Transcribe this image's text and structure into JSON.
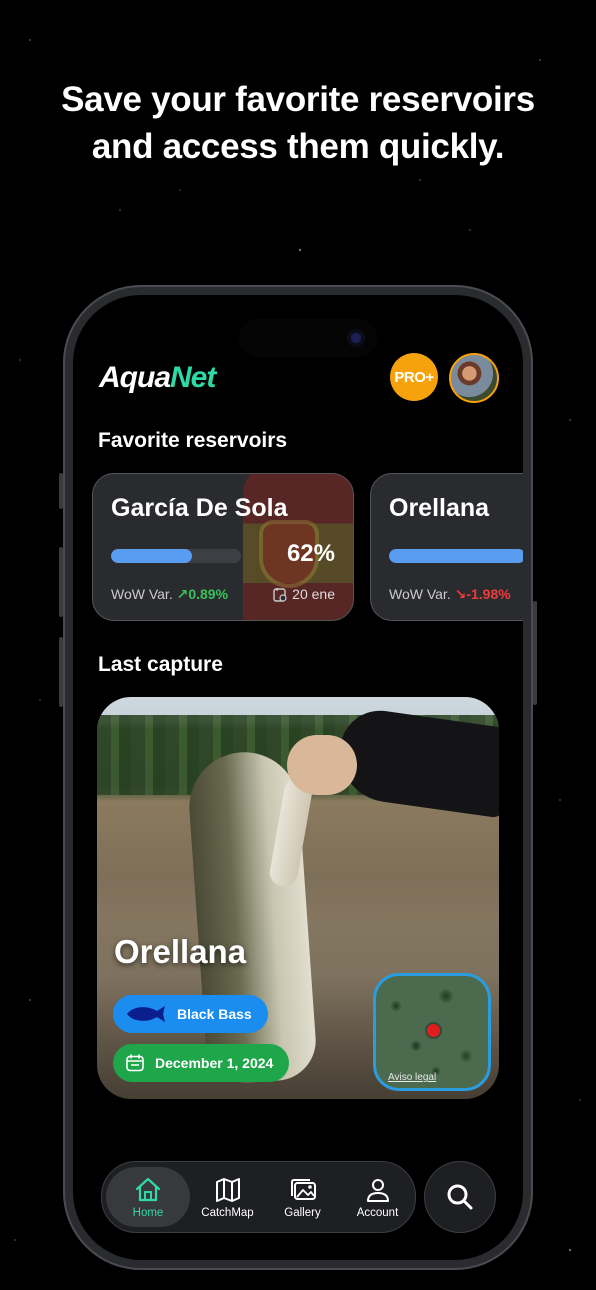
{
  "headline": {
    "line1": "Save your favorite reservoirs",
    "line2": "and access them quickly."
  },
  "app": {
    "logo_part1": "Aqua",
    "logo_part2": "Net",
    "pro_badge": "PRO+",
    "brand_color": "#2fd9a6"
  },
  "favorites": {
    "title": "Favorite reservoirs",
    "cards": [
      {
        "name": "García De Sola",
        "percent_label": "62%",
        "fill_percent": 62,
        "wow_label": "WoW Var.",
        "wow_value": "0.89%",
        "trend": "up",
        "date": "20 ene"
      },
      {
        "name": "Orellana",
        "fill_percent": 80,
        "wow_label": "WoW Var.",
        "wow_value": "-1.98%",
        "trend": "down"
      }
    ]
  },
  "last_capture": {
    "title": "Last capture",
    "place": "Orellana",
    "species": "Black Bass",
    "date": "December 1, 2024",
    "map_legal": "Aviso legal"
  },
  "tabbar": {
    "items": [
      {
        "label": "Home",
        "icon": "home-icon",
        "active": true
      },
      {
        "label": "CatchMap",
        "icon": "map-icon",
        "active": false
      },
      {
        "label": "Gallery",
        "icon": "gallery-icon",
        "active": false
      },
      {
        "label": "Account",
        "icon": "account-icon",
        "active": false
      }
    ]
  }
}
